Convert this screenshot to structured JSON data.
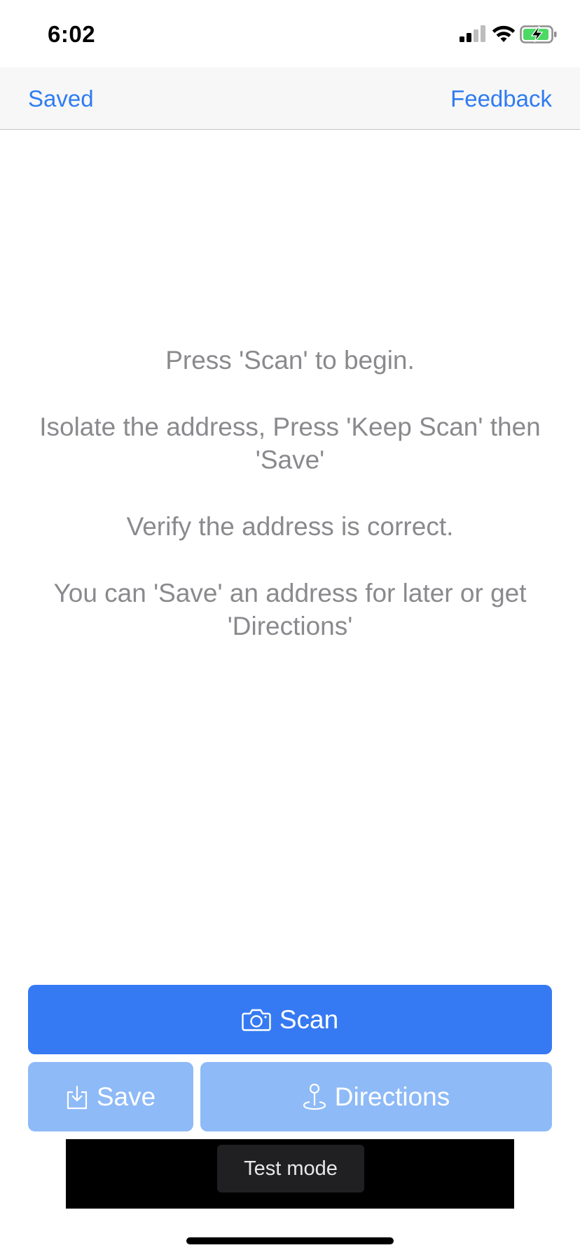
{
  "status_bar": {
    "time": "6:02",
    "icons": [
      "signal-icon",
      "wifi-icon",
      "battery-charging-icon"
    ]
  },
  "nav": {
    "left_label": "Saved",
    "right_label": "Feedback"
  },
  "instructions": [
    "Press 'Scan' to begin.",
    "Isolate the address, Press 'Keep Scan' then 'Save'",
    "Verify the address is correct.",
    "You can 'Save' an address for later or get 'Directions'"
  ],
  "buttons": {
    "scan_label": "Scan",
    "save_label": "Save",
    "directions_label": "Directions"
  },
  "ad": {
    "test_mode_label": "Test mode"
  },
  "colors": {
    "accent": "#2f7cf2",
    "scan_button": "#367af3",
    "disabled_button": "#8ebaf7",
    "instruction_text": "#8a8a8e",
    "battery_fill": "#4cd964"
  }
}
